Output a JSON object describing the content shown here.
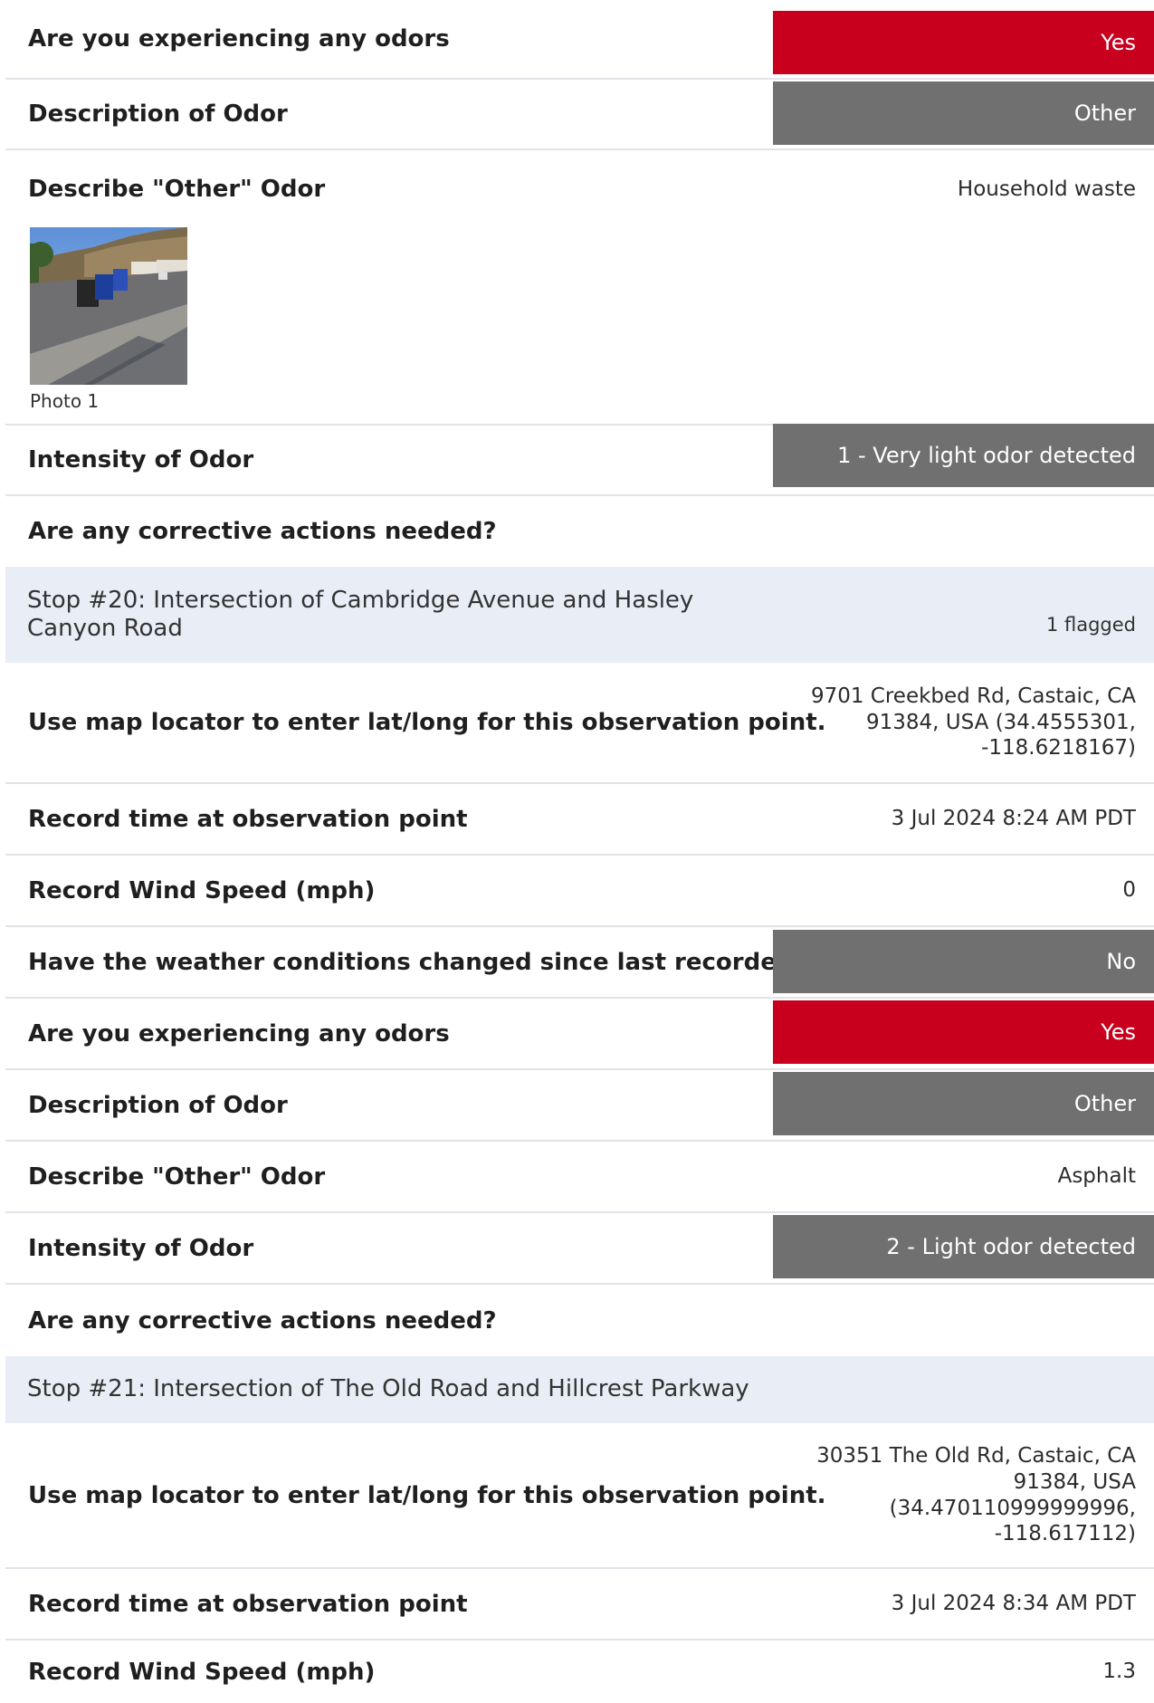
{
  "rows": [
    {
      "question": "Are you experiencing any odors",
      "answer": "Yes"
    },
    {
      "question": "Description of Odor",
      "answer": "Other"
    },
    {
      "question": "Describe \"Other\" Odor",
      "answer": "Household waste"
    },
    {
      "question": "Intensity of Odor",
      "answer": "1 - Very light odor detected"
    },
    {
      "question": "Are any corrective actions needed?",
      "answer": ""
    },
    {
      "question": "Use map locator to enter lat/long for this observation point.",
      "answer": "9701 Creekbed Rd, Castaic, CA 91384, USA (34.4555301, -118.6218167)"
    },
    {
      "question": "Record time at observation point",
      "answer": "3 Jul 2024 8:24 AM PDT"
    },
    {
      "question": "Record Wind Speed (mph)",
      "answer": "0"
    },
    {
      "question": "Have the weather conditions changed since last recorded?",
      "answer": "No"
    },
    {
      "question": "Are you experiencing any odors",
      "answer": "Yes"
    },
    {
      "question": "Description of Odor",
      "answer": "Other"
    },
    {
      "question": "Describe \"Other\" Odor",
      "answer": "Asphalt"
    },
    {
      "question": "Intensity of Odor",
      "answer": "2 - Light odor detected"
    },
    {
      "question": "Are any corrective actions needed?",
      "answer": ""
    },
    {
      "question": "Use map locator to enter lat/long for this observation point.",
      "answer": "30351 The Old Rd, Castaic, CA 91384, USA (34.470110999999996, -118.617112)"
    },
    {
      "question": "Record time at observation point",
      "answer": "3 Jul 2024 8:34 AM PDT"
    },
    {
      "question": "Record Wind Speed (mph)",
      "answer": "1.3"
    }
  ],
  "photo": {
    "caption": "Photo 1"
  },
  "stops": [
    {
      "title": "Stop #20: Intersection of Cambridge Avenue and Hasley Canyon Road",
      "flag": "1 flagged"
    },
    {
      "title": "Stop #21: Intersection of The Old Road and Hillcrest Parkway",
      "flag": ""
    }
  ],
  "colors": {
    "yes": "#c8001e",
    "neutral": "#707070",
    "stop_bg": "#e8edf6",
    "divider": "#e1e3e8"
  }
}
